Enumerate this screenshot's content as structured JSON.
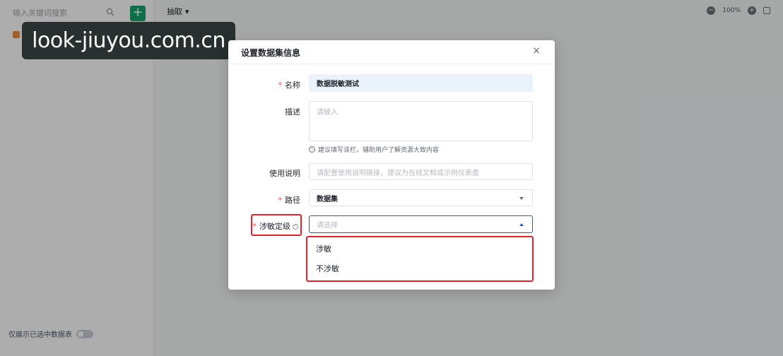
{
  "sidebar": {
    "search_placeholder": "输入关键词搜索",
    "add_label": "+",
    "tree_item": "",
    "toggle_label": "仅展示已选中数据表"
  },
  "topbar": {
    "mode": "抽取",
    "zoom": "100%"
  },
  "watermark": "look-jiuyou.com.cn",
  "dialog": {
    "title": "设置数据集信息",
    "close": "×",
    "fields": {
      "name": {
        "label": "名称",
        "value": "数据脱敏测试"
      },
      "desc": {
        "label": "描述",
        "placeholder": "请输入",
        "hint": "建议填写该栏，辅助用户了解资源大致内容"
      },
      "usage": {
        "label": "使用说明",
        "placeholder": "请配置使用说明链接，建议为在线文档或示例仪表盘"
      },
      "path": {
        "label": "路径",
        "value": "数据集"
      },
      "level": {
        "label": "涉敏定级",
        "placeholder": "请选择"
      }
    },
    "dropdown": {
      "options": [
        "涉敏",
        "不涉敏"
      ]
    }
  },
  "colors": {
    "accent": "#1456f0",
    "required": "#f54a45",
    "highlight_box": "#e5212b",
    "add_button": "#14a46c"
  }
}
